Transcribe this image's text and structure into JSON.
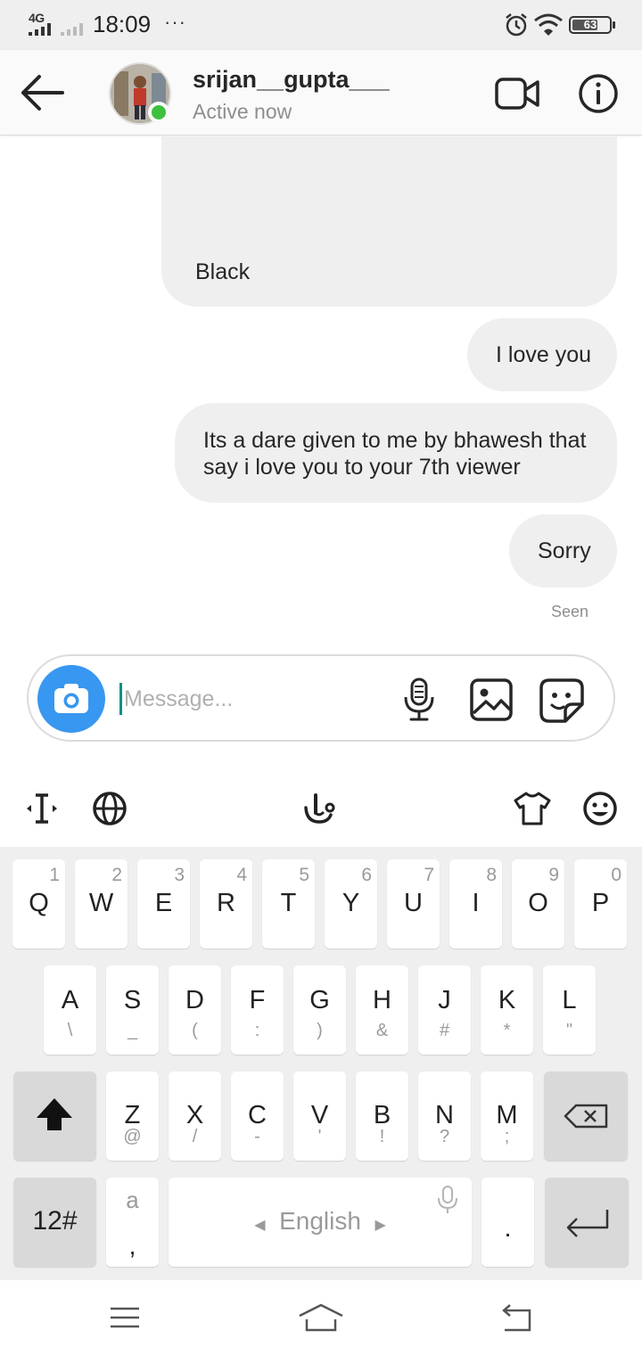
{
  "status_bar": {
    "network": "4G",
    "time": "18:09",
    "more_indicator": "···",
    "battery": "63",
    "icons": [
      "signal-icon",
      "alarm-icon",
      "wifi-icon",
      "battery-icon"
    ]
  },
  "header": {
    "username": "srijan__gupta___",
    "status": "Active now",
    "icons": [
      "back-arrow-icon",
      "video-call-icon",
      "info-icon"
    ],
    "online_color": "#3ec03e"
  },
  "messages": [
    {
      "text": "Black"
    },
    {
      "text": "I love you"
    },
    {
      "text": "Its a dare given to me by bhawesh that say i love you to your 7th viewer"
    },
    {
      "text": "Sorry"
    }
  ],
  "seen_label": "Seen",
  "composer": {
    "placeholder": "Message...",
    "value": "",
    "icons": [
      "camera-icon",
      "microphone-icon",
      "gallery-icon",
      "sticker-icon"
    ],
    "camera_color": "#3897f0"
  },
  "keyboard_toolbar": {
    "icons": [
      "cursor-icon",
      "globe-icon",
      "gesture-icon",
      "theme-shirt-icon",
      "emoji-icon"
    ]
  },
  "keyboard": {
    "row1": [
      {
        "main": "Q",
        "sup": "1"
      },
      {
        "main": "W",
        "sup": "2"
      },
      {
        "main": "E",
        "sup": "3"
      },
      {
        "main": "R",
        "sup": "4"
      },
      {
        "main": "T",
        "sup": "5"
      },
      {
        "main": "Y",
        "sup": "6"
      },
      {
        "main": "U",
        "sup": "7"
      },
      {
        "main": "I",
        "sup": "8"
      },
      {
        "main": "O",
        "sup": "9"
      },
      {
        "main": "P",
        "sup": "0"
      }
    ],
    "row2": [
      {
        "main": "A",
        "sub": "\\"
      },
      {
        "main": "S",
        "sub": "_"
      },
      {
        "main": "D",
        "sub": "("
      },
      {
        "main": "F",
        "sub": ":"
      },
      {
        "main": "G",
        "sub": ")"
      },
      {
        "main": "H",
        "sub": "&"
      },
      {
        "main": "J",
        "sub": "#"
      },
      {
        "main": "K",
        "sub": "*"
      },
      {
        "main": "L",
        "sub": "\""
      }
    ],
    "row3": [
      {
        "main": "Z",
        "sub": "@"
      },
      {
        "main": "X",
        "sub": "/"
      },
      {
        "main": "C",
        "sub": "-"
      },
      {
        "main": "V",
        "sub": "'"
      },
      {
        "main": "B",
        "sub": "!"
      },
      {
        "main": "N",
        "sub": "?"
      },
      {
        "main": "M",
        "sub": ";"
      }
    ],
    "shift_icon": "shift-icon",
    "backspace_icon": "backspace-icon",
    "numbers_label": "12#",
    "comma_key_top": "a",
    "comma_key_bottom": ",",
    "space_label": "English",
    "period_label": ".",
    "enter_icon": "enter-icon"
  },
  "nav_bar": {
    "icons": [
      "menu-icon",
      "home-icon",
      "back-icon"
    ]
  }
}
